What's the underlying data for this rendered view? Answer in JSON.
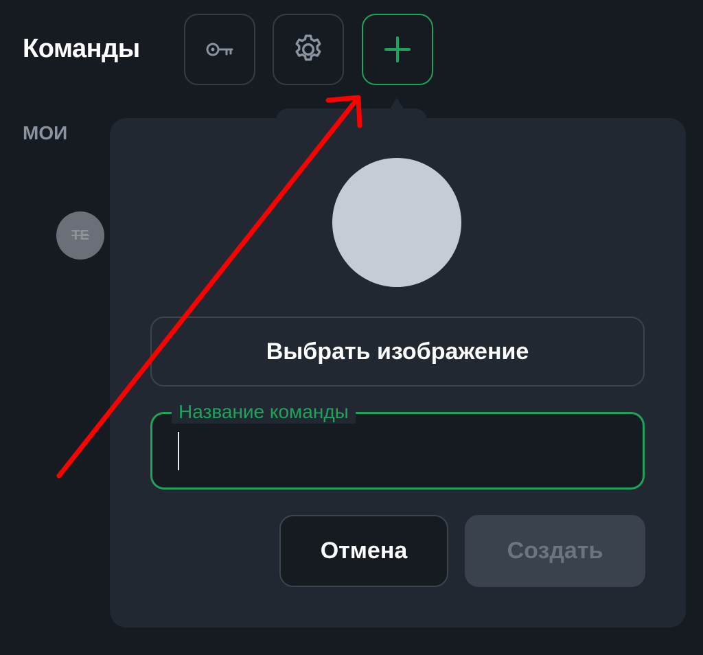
{
  "header": {
    "title": "Команды",
    "key_icon": "key-icon",
    "settings_icon": "gear-icon",
    "add_icon": "plus-icon"
  },
  "section": {
    "label": "МОИ"
  },
  "teams": [
    {
      "initials": "TE"
    }
  ],
  "dialog": {
    "choose_image_label": "Выбрать изображение",
    "name_field": {
      "label": "Название команды",
      "value": ""
    },
    "cancel_label": "Отмена",
    "create_label": "Создать"
  },
  "colors": {
    "background": "#161b22",
    "popover": "#212832",
    "accent": "#1fa35a",
    "annotation_arrow": "#ff0000"
  }
}
